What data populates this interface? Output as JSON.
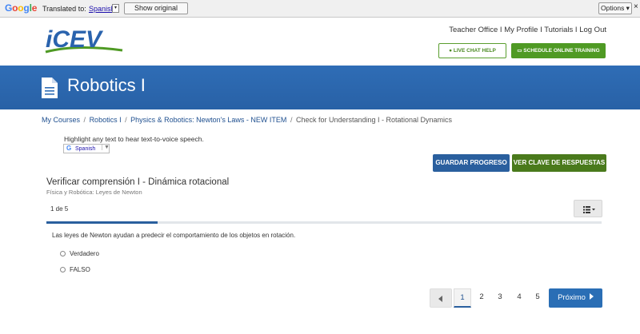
{
  "translate_bar": {
    "logo": [
      "G",
      "o",
      "o",
      "g",
      "l",
      "e"
    ],
    "translated_to": "Translated to:",
    "language": "Spanish",
    "dropdown": "▾",
    "show_original": "Show original",
    "options": "Options ▾",
    "close": "×"
  },
  "header": {
    "logo_text": "iCEV",
    "links": [
      "Teacher Office",
      "My Profile",
      "Tutorials",
      "Log Out"
    ],
    "link_separator": " I ",
    "live_chat": "LIVE CHAT HELP",
    "schedule": "SCHEDULE ONLINE TRAINING"
  },
  "banner": {
    "title": "Robotics I"
  },
  "breadcrumb": {
    "items": [
      "My Courses",
      "Robotics I",
      "Physics & Robotics: Newton's Laws - NEW ITEM"
    ],
    "current": "Check for Understanding I - Rotational Dynamics",
    "separator": "/"
  },
  "tts": {
    "instruction": "Highlight any text to hear text-to-voice speech.",
    "language": "Spanish",
    "caret": "▼"
  },
  "actions": {
    "save_progress": "GUARDAR PROGRESO",
    "answer_key": "VER CLAVE DE RESPUESTAS"
  },
  "quiz": {
    "title": "Verificar comprensión I - Dinámica rotacional",
    "subtitle": "Física y Robótica: Leyes de Newton",
    "counter": "1 de 5",
    "progress_fraction": 0.2,
    "question": "Las leyes de Newton ayudan a predecir el comportamiento de los objetos en rotación.",
    "options": [
      "Verdadero",
      "FALSO"
    ]
  },
  "pagination": {
    "pages": [
      "1",
      "2",
      "3",
      "4",
      "5"
    ],
    "active_page": "1",
    "next_label": "Próximo"
  },
  "colors": {
    "banner_blue": "#2f6db6",
    "brand_green": "#4f9a24",
    "dark_blue_button": "#2a5f9e",
    "dark_green_button": "#4a7a1c",
    "next_button": "#2a6eb5"
  }
}
